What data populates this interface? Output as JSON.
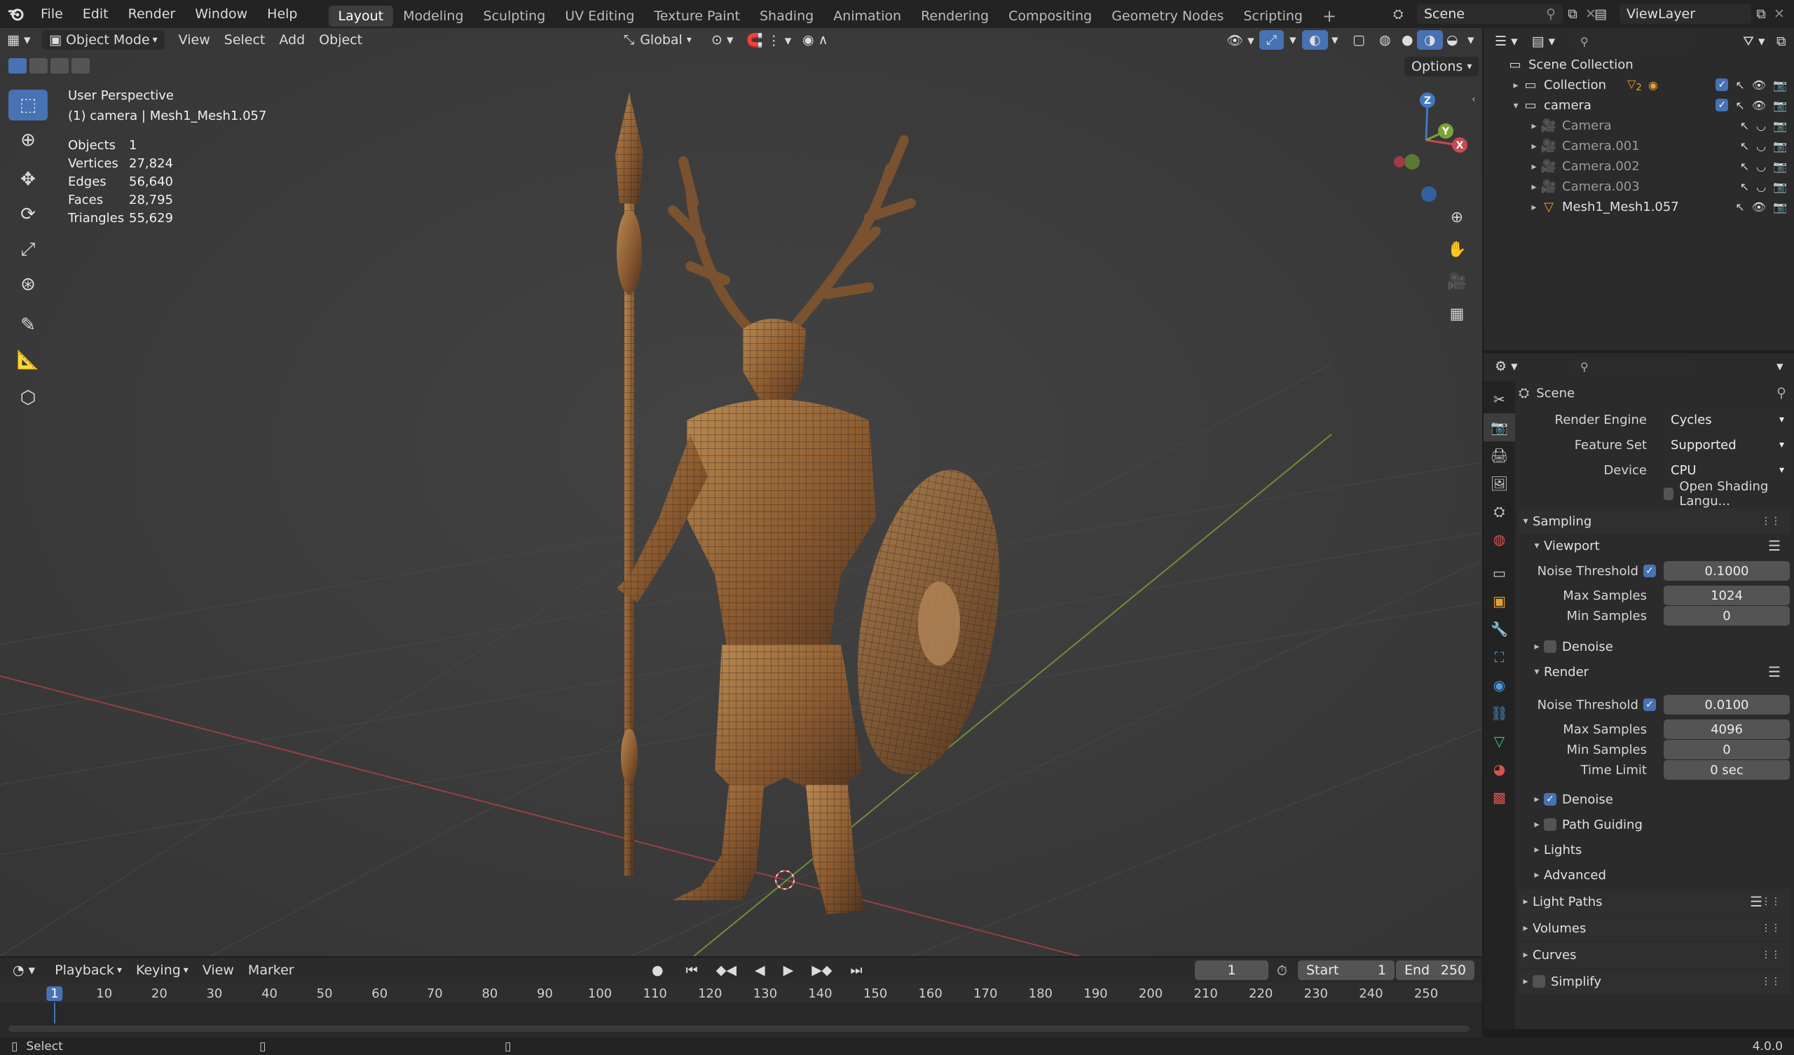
{
  "topbar": {
    "menus": [
      "File",
      "Edit",
      "Render",
      "Window",
      "Help"
    ],
    "workspaces": [
      "Layout",
      "Modeling",
      "Sculpting",
      "UV Editing",
      "Texture Paint",
      "Shading",
      "Animation",
      "Rendering",
      "Compositing",
      "Geometry Nodes",
      "Scripting"
    ],
    "add_tab": "+",
    "scene_name": "Scene",
    "view_layer": "ViewLayer"
  },
  "viewport_header": {
    "mode": "Object Mode",
    "menus": [
      "View",
      "Select",
      "Add",
      "Object"
    ],
    "orientation": "Global",
    "options": "Options"
  },
  "viewport": {
    "perspective": "User Perspective",
    "context": "(1) camera | Mesh1_Mesh1.057",
    "stats": [
      {
        "label": "Objects",
        "value": "1"
      },
      {
        "label": "Vertices",
        "value": "27,824"
      },
      {
        "label": "Edges",
        "value": "56,640"
      },
      {
        "label": "Faces",
        "value": "28,795"
      },
      {
        "label": "Triangles",
        "value": "55,629"
      }
    ],
    "gizmo": {
      "z": "Z",
      "y": "Y",
      "x": "X"
    }
  },
  "outliner": {
    "root": "Scene Collection",
    "items": [
      {
        "label": "Collection",
        "type": "collection",
        "indent": 1,
        "badge": "2",
        "dim": false
      },
      {
        "label": "camera",
        "type": "collection",
        "indent": 1,
        "dim": false
      },
      {
        "label": "Camera",
        "type": "camera",
        "indent": 2,
        "dim": true
      },
      {
        "label": "Camera.001",
        "type": "camera",
        "indent": 2,
        "dim": true
      },
      {
        "label": "Camera.002",
        "type": "camera",
        "indent": 2,
        "dim": true
      },
      {
        "label": "Camera.003",
        "type": "camera",
        "indent": 2,
        "dim": true
      },
      {
        "label": "Mesh1_Mesh1.057",
        "type": "mesh",
        "indent": 2,
        "dim": false
      }
    ]
  },
  "properties": {
    "context": "Scene",
    "render_engine_label": "Render Engine",
    "render_engine": "Cycles",
    "feature_set_label": "Feature Set",
    "feature_set": "Supported",
    "device_label": "Device",
    "device": "CPU",
    "osl_label": "Open Shading Langu...",
    "sampling": "Sampling",
    "viewport": {
      "title": "Viewport",
      "noise_threshold_label": "Noise Threshold",
      "noise_threshold": "0.1000",
      "max_samples_label": "Max Samples",
      "max_samples": "1024",
      "min_samples_label": "Min Samples",
      "min_samples": "0",
      "denoise": "Denoise"
    },
    "render": {
      "title": "Render",
      "noise_threshold_label": "Noise Threshold",
      "noise_threshold": "0.0100",
      "max_samples_label": "Max Samples",
      "max_samples": "4096",
      "min_samples_label": "Min Samples",
      "min_samples": "0",
      "time_limit_label": "Time Limit",
      "time_limit": "0 sec",
      "denoise": "Denoise",
      "path_guiding": "Path Guiding",
      "lights": "Lights",
      "advanced": "Advanced"
    },
    "panels": [
      "Light Paths",
      "Volumes",
      "Curves",
      "Simplify"
    ]
  },
  "timeline": {
    "menus": [
      "Playback",
      "Keying",
      "View",
      "Marker"
    ],
    "current_frame": "1",
    "start_label": "Start",
    "start": "1",
    "end_label": "End",
    "end": "250",
    "ticks": [
      "1",
      "10",
      "20",
      "30",
      "40",
      "50",
      "60",
      "70",
      "80",
      "90",
      "100",
      "110",
      "120",
      "130",
      "140",
      "150",
      "160",
      "170",
      "180",
      "190",
      "200",
      "210",
      "220",
      "230",
      "240",
      "250"
    ]
  },
  "statusbar": {
    "action": "Select",
    "version": "4.0.0"
  },
  "colors": {
    "accent": "#4772b3",
    "x_axis": "#c74a52",
    "y_axis": "#7aa33a",
    "z_axis": "#3f79c8"
  }
}
